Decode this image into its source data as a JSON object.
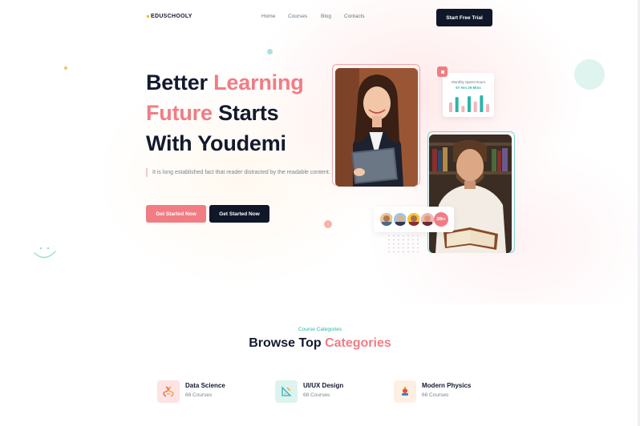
{
  "header": {
    "logo_text": "EDUSCHOOLY",
    "nav": [
      "Home",
      "Courses",
      "Blog",
      "Contacts"
    ],
    "cta": "Start Free Trial"
  },
  "hero": {
    "headline_1": "Better",
    "headline_2": "Learning",
    "headline_3": "Future",
    "headline_4": "Starts",
    "headline_5": "With Youdemi",
    "description": "It is long established fact that reader distracted by the readable content.",
    "primary_button": "Get Started Now",
    "secondary_button": "Get Started Now"
  },
  "stats_card": {
    "title": "Monthly Spent Hours",
    "value": "67 Hrs 29 Mins",
    "bars": [
      0.55,
      0.85,
      0.35,
      0.9,
      0.6,
      0.95,
      0.45
    ],
    "icon": "square-badge-icon"
  },
  "students": {
    "count": "28k+",
    "avatars": [
      "avatar-1",
      "avatar-2",
      "avatar-3",
      "avatar-4"
    ]
  },
  "categories": {
    "tag": "Course Categories",
    "title_1": "Browse Top",
    "title_2": "Categories",
    "items": [
      {
        "name": "Data Science",
        "count": "68 Courses",
        "icon": "dna-icon"
      },
      {
        "name": "UI/UX Design",
        "count": "68 Courses",
        "icon": "design-ruler-icon"
      },
      {
        "name": "Modern Physics",
        "count": "68 Courses",
        "icon": "flask-icon"
      }
    ]
  },
  "colors": {
    "accent": "#f27c84",
    "teal": "#2bb5a8",
    "dark": "#0f1729"
  }
}
